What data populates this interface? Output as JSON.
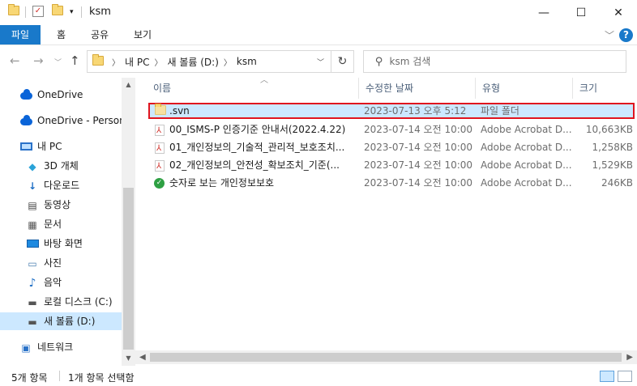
{
  "window": {
    "title": "ksm"
  },
  "ribbon": {
    "tabs": [
      "파일",
      "홈",
      "공유",
      "보기"
    ],
    "help": "?"
  },
  "address": {
    "crumbs": [
      "내 PC",
      "새 볼륨 (D:)",
      "ksm"
    ]
  },
  "search": {
    "placeholder": "ksm 검색"
  },
  "nav": {
    "items": [
      {
        "label": "OneDrive",
        "icon": "onedrive-icon"
      },
      {
        "label": "OneDrive - Persona",
        "icon": "onedrive-icon"
      },
      {
        "label": "내 PC",
        "icon": "pc-icon"
      },
      {
        "label": "3D 개체",
        "icon": "3d-objects-icon"
      },
      {
        "label": "다운로드",
        "icon": "download-icon"
      },
      {
        "label": "동영상",
        "icon": "video-icon"
      },
      {
        "label": "문서",
        "icon": "document-icon"
      },
      {
        "label": "바탕 화면",
        "icon": "desktop-icon"
      },
      {
        "label": "사진",
        "icon": "pictures-icon"
      },
      {
        "label": "음악",
        "icon": "music-icon"
      },
      {
        "label": "로컬 디스크 (C:)",
        "icon": "drive-icon"
      },
      {
        "label": "새 볼륨 (D:)",
        "icon": "drive-icon"
      },
      {
        "label": "네트워크",
        "icon": "network-icon"
      }
    ]
  },
  "columns": {
    "name": "이름",
    "modified": "수정한 날짜",
    "type": "유형",
    "size": "크기"
  },
  "files": [
    {
      "name": ".svn",
      "modified": "2023-07-13 오후 5:12",
      "type": "파일 폴더",
      "size": "",
      "icon": "folder-icon"
    },
    {
      "name": "00_ISMS-P 인증기준 안내서(2022.4.22)",
      "modified": "2023-07-14 오전 10:00",
      "type": "Adobe Acrobat D...",
      "size": "10,663KB",
      "icon": "pdf-icon"
    },
    {
      "name": "01_개인정보의_기술적_관리적_보호조치...",
      "modified": "2023-07-14 오전 10:00",
      "type": "Adobe Acrobat D...",
      "size": "1,258KB",
      "icon": "pdf-icon"
    },
    {
      "name": "02_개인정보의_안전성_확보조치_기준(...",
      "modified": "2023-07-14 오전 10:00",
      "type": "Adobe Acrobat D...",
      "size": "1,529KB",
      "icon": "pdf-icon"
    },
    {
      "name": "숫자로 보는 개인정보보호",
      "modified": "2023-07-14 오전 10:00",
      "type": "Adobe Acrobat D...",
      "size": "246KB",
      "icon": "pdf-check-icon"
    }
  ],
  "status": {
    "count": "5개 항목",
    "selected": "1개 항목 선택함"
  },
  "colors": {
    "accent": "#1979ca",
    "selection": "#cce8ff",
    "highlight_border": "#e0141e"
  }
}
